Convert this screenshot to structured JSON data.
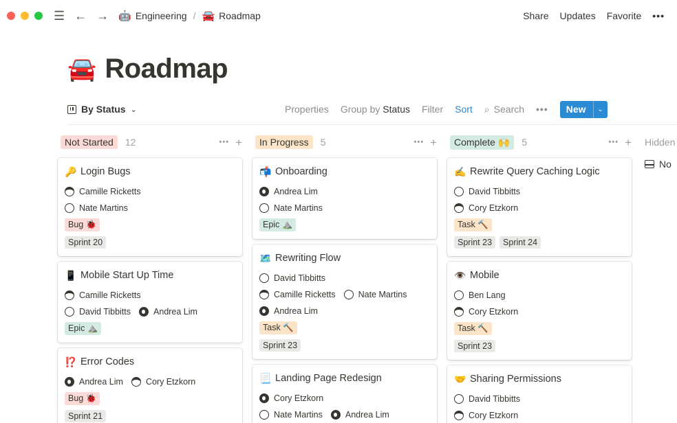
{
  "colors": {
    "accent": "#2b8ad4",
    "sort": "#2e88c9",
    "red_tag": "#fbdad7",
    "orange_tag": "#fbe4c7",
    "green_tag": "#d4ebe4",
    "gray_tag": "#e9e9e7"
  },
  "topbar": {
    "menu_icon": "☰",
    "back_icon": "←",
    "forward_icon": "→",
    "crumbs": [
      {
        "emoji": "🤖",
        "label": "Engineering"
      },
      {
        "emoji": "🚘",
        "label": "Roadmap"
      }
    ],
    "separator": "/",
    "actions": {
      "share": "Share",
      "updates": "Updates",
      "favorite": "Favorite",
      "more": "•••"
    }
  },
  "page": {
    "emoji": "🚘",
    "title": "Roadmap"
  },
  "view": {
    "name": "By Status",
    "caret": "⌄",
    "properties": "Properties",
    "group_by": "Group by",
    "group_value": "Status",
    "filter": "Filter",
    "sort": "Sort",
    "search_icon": "⌕",
    "search": "Search",
    "more": "•••",
    "new": "New",
    "new_caret": "⌄"
  },
  "board": {
    "columns": [
      {
        "name": "Not Started",
        "count": "12",
        "color": "red",
        "cards": [
          {
            "emoji": "🔑",
            "title": "Login Bugs",
            "people": [
              [
                "Camille Ricketts"
              ],
              [
                "Nate Martins"
              ]
            ],
            "tags": [
              [
                "Bug 🐞"
              ],
              [
                "Sprint 20"
              ]
            ]
          },
          {
            "emoji": "📱",
            "title": "Mobile Start Up Time",
            "people": [
              [
                "Camille Ricketts"
              ],
              [
                "David Tibbitts",
                "Andrea Lim"
              ]
            ],
            "tags": [
              [
                "Epic ⛰️"
              ]
            ]
          },
          {
            "emoji": "⁉️",
            "title": "Error Codes",
            "people": [
              [
                "Andrea Lim",
                "Cory Etzkorn"
              ]
            ],
            "tags": [
              [
                "Bug 🐞"
              ],
              [
                "Sprint 21"
              ]
            ]
          }
        ]
      },
      {
        "name": "In Progress",
        "count": "5",
        "color": "orange",
        "cards": [
          {
            "emoji": "📬",
            "title": "Onboarding",
            "people": [
              [
                "Andrea Lim"
              ],
              [
                "Nate Martins"
              ]
            ],
            "tags": [
              [
                "Epic ⛰️"
              ]
            ]
          },
          {
            "emoji": "🗺️",
            "title": "Rewriting Flow",
            "people": [
              [
                "David Tibbitts"
              ],
              [
                "Camille Ricketts",
                "Nate Martins"
              ],
              [
                "Andrea Lim"
              ]
            ],
            "tags": [
              [
                "Task 🔨"
              ],
              [
                "Sprint 23"
              ]
            ]
          },
          {
            "emoji": "📃",
            "title": "Landing Page Redesign",
            "people": [
              [
                "Cory Etzkorn"
              ],
              [
                "Nate Martins",
                "Andrea Lim"
              ]
            ],
            "tags": []
          }
        ]
      },
      {
        "name": "Complete 🙌",
        "count": "5",
        "color": "green",
        "cards": [
          {
            "emoji": "✍️",
            "title": "Rewrite Query Caching Logic",
            "people": [
              [
                "David Tibbitts"
              ],
              [
                "Cory Etzkorn"
              ]
            ],
            "tags": [
              [
                "Task 🔨"
              ],
              [
                "Sprint 23",
                "Sprint 24"
              ]
            ]
          },
          {
            "emoji": "👁️",
            "title": "Mobile",
            "people": [
              [
                "Ben Lang"
              ],
              [
                "Cory Etzkorn"
              ]
            ],
            "tags": [
              [
                "Task 🔨"
              ],
              [
                "Sprint 23"
              ]
            ]
          },
          {
            "emoji": "🤝",
            "title": "Sharing Permissions",
            "people": [
              [
                "David Tibbitts"
              ],
              [
                "Cory Etzkorn"
              ]
            ],
            "tags": []
          }
        ]
      }
    ],
    "hidden": {
      "label": "Hidden",
      "item": "No"
    }
  }
}
